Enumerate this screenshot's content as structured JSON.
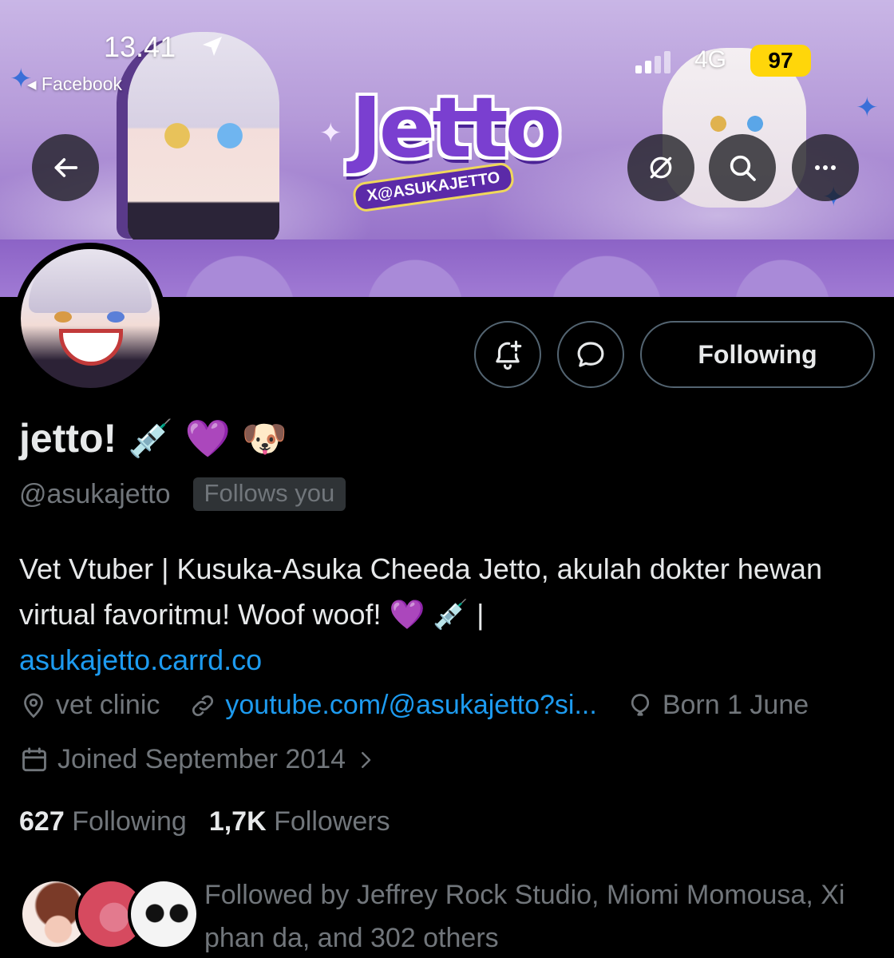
{
  "status_bar": {
    "time": "13.41",
    "back_app": "◂ Facebook",
    "network": "4G",
    "battery": "97"
  },
  "banner": {
    "logo_text": "Jetto",
    "logo_handle": "X@ASUKAJETTO"
  },
  "profile": {
    "display_name": "jetto!",
    "name_emojis": [
      "💉",
      "💜",
      "🐶"
    ],
    "handle": "@asukajetto",
    "follows_you_badge": "Follows you",
    "bio_text": "Vet Vtuber | Kusuka-Asuka Cheeda Jetto, akulah dokter hewan virtual favoritmu! Woof woof! 💜 💉 |",
    "bio_link": "asukajetto.carrd.co",
    "location": "vet clinic",
    "website": "youtube.com/@asukajetto?si...",
    "birthday": "Born 1 June",
    "joined": "Joined September 2014"
  },
  "actions": {
    "following_label": "Following"
  },
  "stats": {
    "following_count": "627",
    "following_label": "Following",
    "followers_count": "1,7K",
    "followers_label": "Followers"
  },
  "followed_by": "Followed by Jeffrey Rock Studio, Miomi Momousa, Xi phan da, and 302 others",
  "icons": [
    "back-arrow-icon",
    "hide-reposts-icon",
    "search-icon",
    "more-icon",
    "notify-bell-icon",
    "message-icon",
    "location-icon",
    "link-icon",
    "balloon-icon",
    "calendar-icon",
    "chevron-right-icon",
    "location-arrow-icon"
  ],
  "colors": {
    "background": "#000000",
    "text_primary": "#e7e9ea",
    "text_secondary": "#71767b",
    "link": "#1d9bf0",
    "border": "#536471",
    "battery": "#ffd60a",
    "banner_purple": "#9b78cc"
  }
}
